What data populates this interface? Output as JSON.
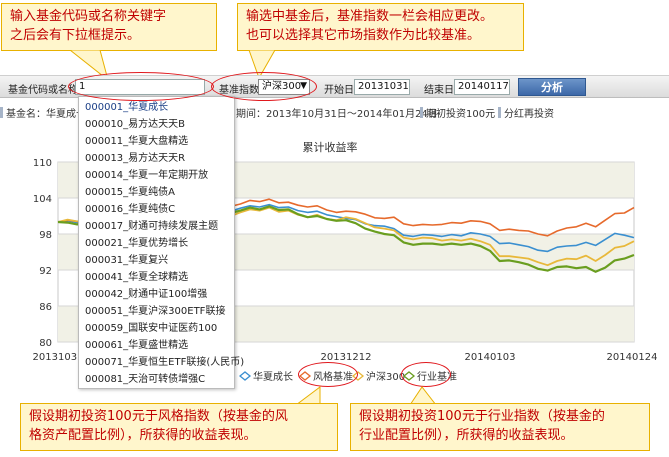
{
  "callouts": {
    "top_left": [
      "输入基金代码或名称关键字",
      "之后会有下拉框提示。"
    ],
    "top_right": [
      "输选中基金后，基准指数一栏会相应更改。",
      "也可以选择其它市场指数作为比较基准。"
    ],
    "bottom_left": [
      "假设期初投资100元于风格指数（按基金的风",
      "格资产配置比例），所获得的收益表现。"
    ],
    "bottom_right": [
      "假设期初投资100元于行业指数（按基金的",
      "行业配置比例），所获得的收益表现。"
    ]
  },
  "toolbar": {
    "code_label": "基金代码或名称",
    "code_value": "1",
    "benchmark_label": "基准指数",
    "benchmark_value": "沪深300",
    "start_label": "开始日",
    "start_value": "20131031",
    "end_label": "结束日",
    "end_value": "20140117",
    "analyze_label": "分析"
  },
  "infobar": {
    "fund_name": "基金名：华夏成长",
    "period": "期间：2013年10月31日～2014年01月24日",
    "initial": "期初投资100元",
    "dividend": "分红再投资"
  },
  "dropdown": {
    "items": [
      "000001_华夏成长",
      "000010_易方达天天B",
      "000011_华夏大盘精选",
      "000013_易方达天天R",
      "000014_华夏一年定期开放",
      "000015_华夏纯债A",
      "000016_华夏纯债C",
      "000017_财通可持续发展主题",
      "000021_华夏优势增长",
      "000031_华夏复兴",
      "000041_华夏全球精选",
      "000042_财通中证100增强",
      "000051_华夏沪深300ETF联接",
      "000059_国联安中证医药100",
      "000061_华夏盛世精选",
      "000071_华夏恒生ETF联接(人民币)",
      "000081_天治可转债增强C"
    ]
  },
  "colors": {
    "fund": "#3a8fd0",
    "style": "#e66a2c",
    "hs300": "#e8b83a",
    "industry": "#6a9e1f",
    "highlight": "#e0181d"
  },
  "chart_data": {
    "type": "line",
    "title": "累计收益率",
    "xlabel": "",
    "ylabel": "",
    "ylim": [
      80,
      110
    ],
    "yticks": [
      "110",
      "104",
      "98",
      "92",
      "86",
      "80"
    ],
    "xticks": [
      "20131031",
      "20131212",
      "20140103",
      "20140124"
    ],
    "x": [
      "20131031",
      "20131101",
      "20131104",
      "20131105",
      "20131106",
      "20131107",
      "20131108",
      "20131111",
      "20131112",
      "20131113",
      "20131114",
      "20131115",
      "20131118",
      "20131119",
      "20131120",
      "20131121",
      "20131122",
      "20131125",
      "20131126",
      "20131127",
      "20131128",
      "20131129",
      "20131202",
      "20131203",
      "20131204",
      "20131205",
      "20131206",
      "20131209",
      "20131210",
      "20131211",
      "20131212",
      "20131213",
      "20131216",
      "20131217",
      "20131218",
      "20131219",
      "20131220",
      "20131223",
      "20131224",
      "20131225",
      "20131226",
      "20131227",
      "20131230",
      "20131231",
      "20140102",
      "20140103",
      "20140106",
      "20140107",
      "20140108",
      "20140109",
      "20140110",
      "20140113",
      "20140114",
      "20140115",
      "20140116",
      "20140117",
      "20140120",
      "20140121",
      "20140122",
      "20140123",
      "20140124"
    ],
    "series": [
      {
        "name": "华夏成长",
        "values": [
          100.0,
          100.2,
          99.9,
          100.1,
          100.4,
          99.8,
          99.6,
          100.2,
          100.9,
          100.0,
          100.4,
          101.2,
          102.6,
          102.2,
          102.0,
          102.5,
          102.3,
          102.0,
          101.8,
          102.3,
          102.7,
          102.5,
          102.9,
          102.4,
          102.5,
          101.9,
          101.6,
          101.8,
          101.2,
          100.9,
          100.6,
          100.4,
          99.7,
          99.4,
          99.3,
          98.9,
          97.8,
          97.6,
          97.9,
          97.8,
          97.6,
          97.9,
          97.7,
          98.2,
          98.0,
          97.6,
          96.4,
          96.5,
          96.2,
          95.9,
          95.3,
          95.1,
          95.8,
          96.0,
          96.1,
          96.6,
          96.1,
          97.1,
          98.1,
          97.8,
          97.4
        ]
      },
      {
        "name": "风格基准",
        "values": [
          100.0,
          100.3,
          100.1,
          100.3,
          100.6,
          100.1,
          99.9,
          100.5,
          101.3,
          100.6,
          101.0,
          102.1,
          103.3,
          103.1,
          102.8,
          103.2,
          103.0,
          102.6,
          102.6,
          103.0,
          103.6,
          103.4,
          103.8,
          103.2,
          103.3,
          102.8,
          102.5,
          102.7,
          102.0,
          101.6,
          101.8,
          101.7,
          101.3,
          100.7,
          100.6,
          100.8,
          99.7,
          99.4,
          99.6,
          99.5,
          99.6,
          99.9,
          99.8,
          100.2,
          100.1,
          99.7,
          98.6,
          98.8,
          98.6,
          98.5,
          98.0,
          97.7,
          98.5,
          99.0,
          99.2,
          99.8,
          99.2,
          100.3,
          101.4,
          101.5,
          102.4
        ]
      },
      {
        "name": "沪深300",
        "values": [
          100.0,
          100.4,
          100.1,
          100.2,
          100.3,
          99.4,
          98.9,
          99.3,
          100.2,
          99.2,
          99.6,
          100.9,
          102.2,
          101.9,
          101.7,
          102.0,
          101.7,
          101.1,
          101.0,
          101.6,
          102.1,
          101.9,
          102.4,
          101.7,
          101.9,
          101.2,
          100.8,
          101.2,
          100.5,
          100.3,
          100.8,
          100.5,
          99.8,
          99.1,
          98.9,
          98.6,
          97.4,
          97.1,
          97.4,
          97.3,
          96.9,
          97.1,
          96.9,
          97.2,
          96.8,
          96.2,
          94.3,
          94.3,
          94.1,
          93.9,
          93.3,
          92.8,
          93.5,
          93.9,
          93.8,
          94.4,
          93.5,
          94.5,
          95.7,
          96.0,
          96.8
        ]
      },
      {
        "name": "行业基准",
        "values": [
          100.0,
          99.9,
          99.6,
          99.8,
          100.2,
          99.7,
          99.3,
          99.9,
          100.6,
          99.8,
          100.1,
          101.2,
          102.7,
          102.3,
          102.0,
          102.6,
          102.2,
          101.6,
          101.5,
          101.9,
          102.4,
          102.1,
          102.6,
          102.0,
          102.1,
          101.3,
          100.8,
          101.0,
          100.5,
          100.2,
          100.3,
          99.8,
          98.9,
          98.4,
          98.0,
          97.8,
          96.6,
          96.2,
          96.4,
          96.4,
          96.2,
          96.4,
          96.2,
          96.4,
          96.0,
          95.2,
          93.5,
          93.6,
          93.3,
          92.9,
          92.2,
          91.9,
          92.5,
          92.6,
          92.3,
          92.5,
          91.7,
          92.4,
          93.6,
          93.9,
          94.5
        ]
      }
    ]
  }
}
